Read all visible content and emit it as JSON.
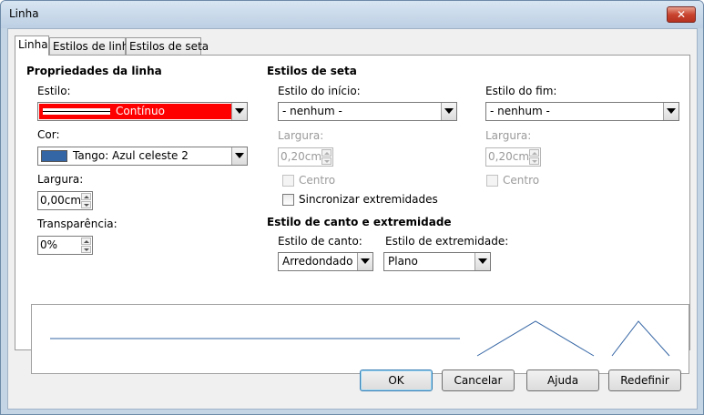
{
  "window": {
    "title": "Linha",
    "close_glyph": "✕"
  },
  "tabs": [
    {
      "label": "Linha",
      "active": true
    },
    {
      "label": "Estilos de linha",
      "active": false
    },
    {
      "label": "Estilos de seta",
      "active": false
    }
  ],
  "line_props": {
    "section": "Propriedades da linha",
    "style_label": "Estilo:",
    "style_value": "Contínuo",
    "color_label": "Cor:",
    "color_value": "Tango: Azul celeste 2",
    "color_swatch": "#3465a4",
    "width_label": "Largura:",
    "width_value": "0,00cm",
    "transparency_label": "Transparência:",
    "transparency_value": "0%"
  },
  "arrow_styles": {
    "section": "Estilos de seta",
    "start_label": "Estilo do início:",
    "start_value": "- nenhum -",
    "end_label": "Estilo do fim:",
    "end_value": "- nenhum -",
    "start_width_label": "Largura:",
    "start_width_value": "0,20cm",
    "end_width_label": "Largura:",
    "end_width_value": "0,20cm",
    "start_center_label": "Centro",
    "end_center_label": "Centro",
    "sync_label": "Sincronizar extremidades"
  },
  "corner_styles": {
    "section": "Estilo de canto e extremidade",
    "corner_label": "Estilo de canto:",
    "corner_value": "Arredondado",
    "cap_label": "Estilo de extremidade:",
    "cap_value": "Plano"
  },
  "colors": {
    "style_highlight": "#ff0000",
    "preview_line": "#3465a4"
  },
  "buttons": {
    "ok": "OK",
    "cancel": "Cancelar",
    "help": "Ajuda",
    "reset": "Redefinir"
  }
}
